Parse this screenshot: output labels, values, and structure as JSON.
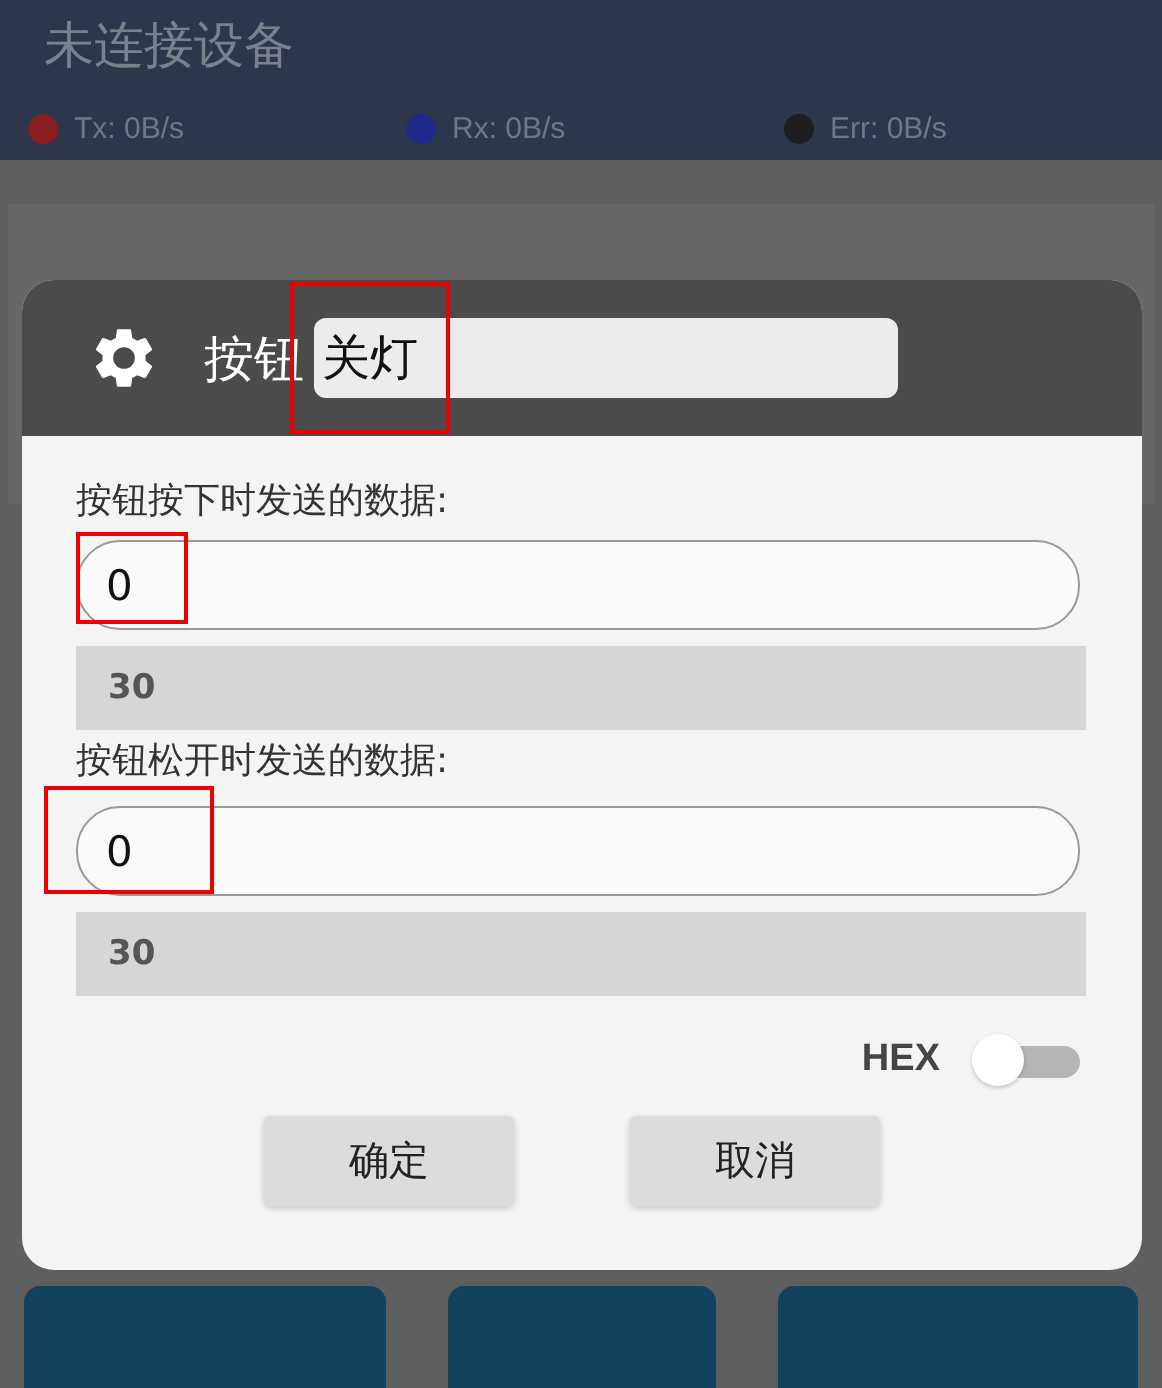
{
  "app_bar": {
    "title": "未连接设备",
    "stats": [
      {
        "label": "Tx: 0B/s",
        "color": "#8a1c22"
      },
      {
        "label": "Rx: 0B/s",
        "color": "#1f2a8c"
      },
      {
        "label": "Err: 0B/s",
        "color": "#1e1e1e"
      }
    ]
  },
  "dialog": {
    "title": "按钮",
    "name_field": {
      "value": "关灯",
      "highlighted": true
    },
    "sections": [
      {
        "label": "按钮按下时发送的数据:",
        "value": "0",
        "highlighted": true,
        "preview": "30"
      },
      {
        "label": "按钮松开时发送的数据:",
        "value": "0",
        "highlighted": true,
        "preview": "30"
      }
    ],
    "hex": {
      "label": "HEX",
      "on": false
    },
    "buttons": [
      "确定",
      "取消"
    ]
  }
}
